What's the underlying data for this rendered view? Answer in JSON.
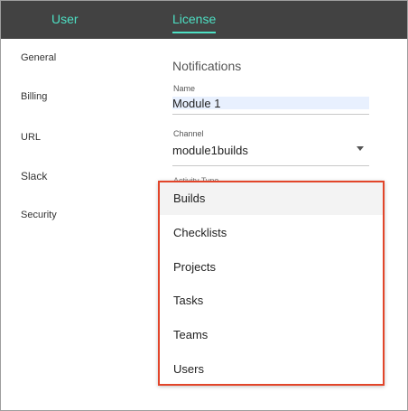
{
  "header": {
    "tabs": [
      {
        "label": "User"
      },
      {
        "label": "License"
      }
    ],
    "accent_color": "#4de0c4",
    "bar_color": "#424242"
  },
  "sidebar": {
    "items": [
      {
        "label": "General"
      },
      {
        "label": "Billing"
      },
      {
        "label": "URL"
      },
      {
        "label": "Slack"
      },
      {
        "label": "Security"
      }
    ]
  },
  "form": {
    "section_title": "Notifications",
    "name_label": "Name",
    "name_value": "Module 1",
    "channel_label": "Channel",
    "channel_value": "module1builds",
    "activity_type_label": "Activity Type"
  },
  "dropdown": {
    "highlight_color": "#e2452a",
    "options": [
      {
        "label": "Builds",
        "hovered": true
      },
      {
        "label": "Checklists"
      },
      {
        "label": "Projects"
      },
      {
        "label": "Tasks"
      },
      {
        "label": "Teams"
      },
      {
        "label": "Users"
      }
    ]
  }
}
